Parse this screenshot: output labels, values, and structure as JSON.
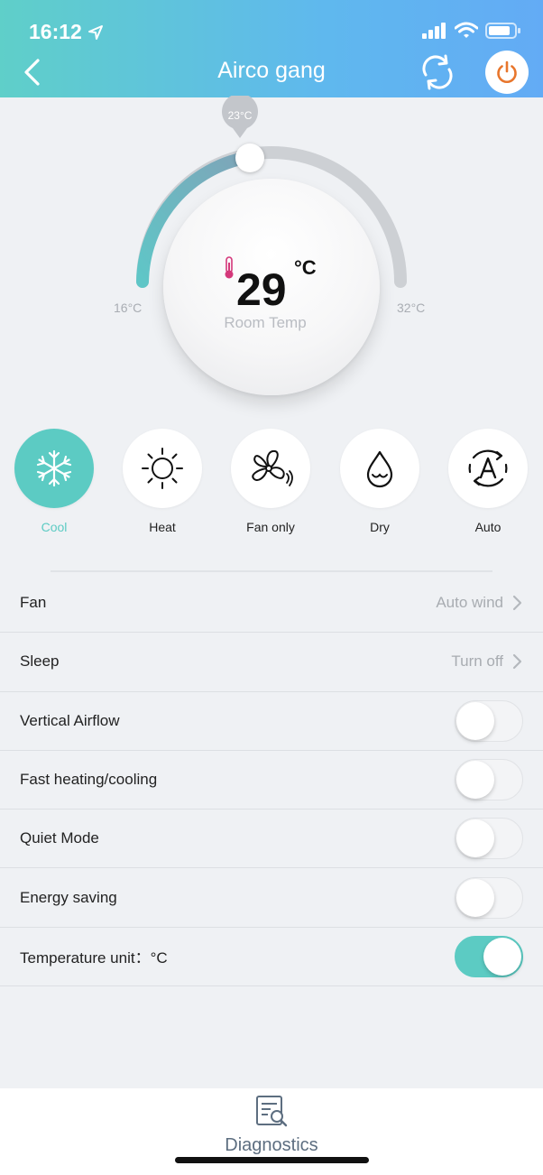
{
  "status_bar": {
    "time": "16:12"
  },
  "header": {
    "title": "Airco gang"
  },
  "dial": {
    "current_temp": "29",
    "unit": "°C",
    "room_label": "Room Temp",
    "setpoint": "23°C",
    "min_label": "16°C",
    "max_label": "32°C",
    "setpoint_value": 23,
    "range": [
      16,
      32
    ]
  },
  "modes": [
    {
      "label": "Cool",
      "icon": "snowflake-icon",
      "active": true
    },
    {
      "label": "Heat",
      "icon": "sun-icon",
      "active": false
    },
    {
      "label": "Fan only",
      "icon": "fan-icon",
      "active": false
    },
    {
      "label": "Dry",
      "icon": "water-drop-icon",
      "active": false
    },
    {
      "label": "Auto",
      "icon": "auto-icon",
      "active": false
    }
  ],
  "settings": [
    {
      "label": "Fan",
      "value": "Auto wind",
      "type": "link"
    },
    {
      "label": "Sleep",
      "value": "Turn off",
      "type": "link"
    },
    {
      "label": "Vertical Airflow",
      "type": "toggle",
      "on": false
    },
    {
      "label": "Fast heating/cooling",
      "type": "toggle",
      "on": false
    },
    {
      "label": "Quiet Mode",
      "type": "toggle",
      "on": false
    },
    {
      "label": "Energy saving",
      "type": "toggle",
      "on": false
    },
    {
      "label": "Temperature unit：°C",
      "type": "toggle",
      "on": true
    }
  ],
  "bottom": {
    "diagnostics_label": "Diagnostics"
  },
  "colors": {
    "accent": "#5ccbc3",
    "power": "#e8762c",
    "header_start": "#5fcfc9",
    "header_end": "#63abf5"
  }
}
